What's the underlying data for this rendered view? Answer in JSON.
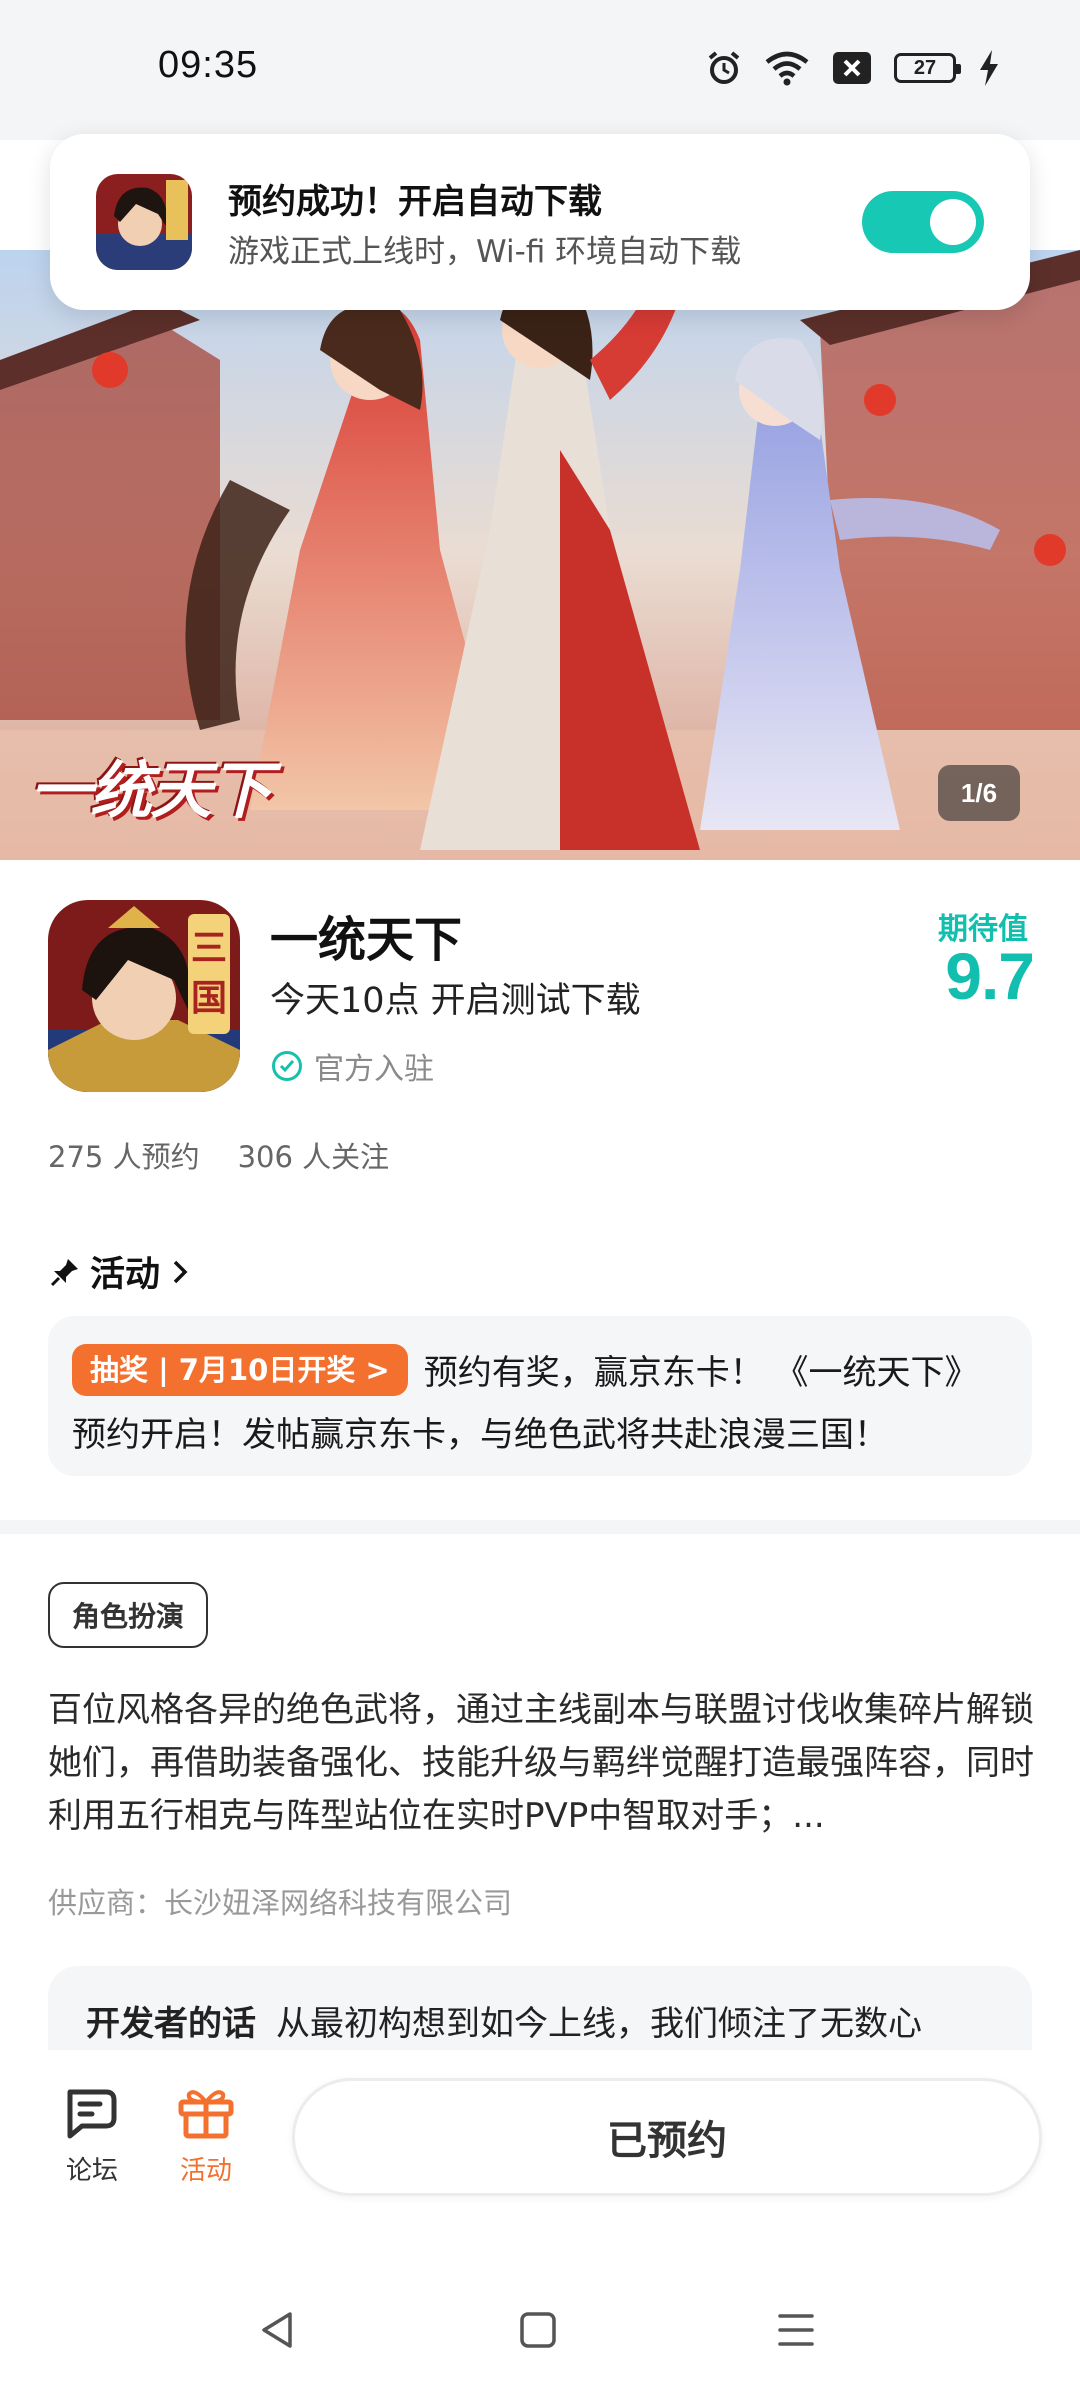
{
  "status_bar": {
    "time": "09:35",
    "battery": "27",
    "icons": [
      "alarm-icon",
      "wifi-icon",
      "no-sim-icon",
      "battery-icon",
      "charging-icon"
    ]
  },
  "toast": {
    "title": "预约成功！开启自动下载",
    "subtitle": "游戏正式上线时，Wi-fi 环境自动下载",
    "toggle_on": true,
    "accent": "#17c9b4"
  },
  "banner": {
    "title": "一统天下",
    "pager": "1/6"
  },
  "game": {
    "name": "一统天下",
    "subtitle": "今天10点 开启测试下载",
    "official": "官方入驻",
    "icon_text": "三国",
    "expect_label": "期待值",
    "expect_value": "9.7",
    "reservations": "275 人预约",
    "followers": "306 人关注"
  },
  "activity": {
    "heading": "活动",
    "tag": "抽奖 | 7月10日开奖 >",
    "text": "预约有奖，赢京东卡！ 《一统天下》预约开启！发帖赢京东卡，与绝色武将共赴浪漫三国！",
    "tag_color": "#f4702e"
  },
  "description": {
    "genre": "角色扮演",
    "text": "百位风格各异的绝色武将，通过主线副本与联盟讨伐收集碎片解锁她们，再借助装备强化、技能升级与羁绊觉醒打造最强阵容，同时利用五行相克与阵型站位在实时PVP中智取对手；...",
    "supplier": "供应商：长沙妞泽网络科技有限公司",
    "dev_label": "开发者的话",
    "dev_text": "从最初构想到如今上线，我们倾注了无数心"
  },
  "bottom_bar": {
    "forum_label": "论坛",
    "activity_label": "活动",
    "reserve_button": "已预约"
  },
  "system_nav": [
    "back-icon",
    "home-icon",
    "menu-icon"
  ]
}
